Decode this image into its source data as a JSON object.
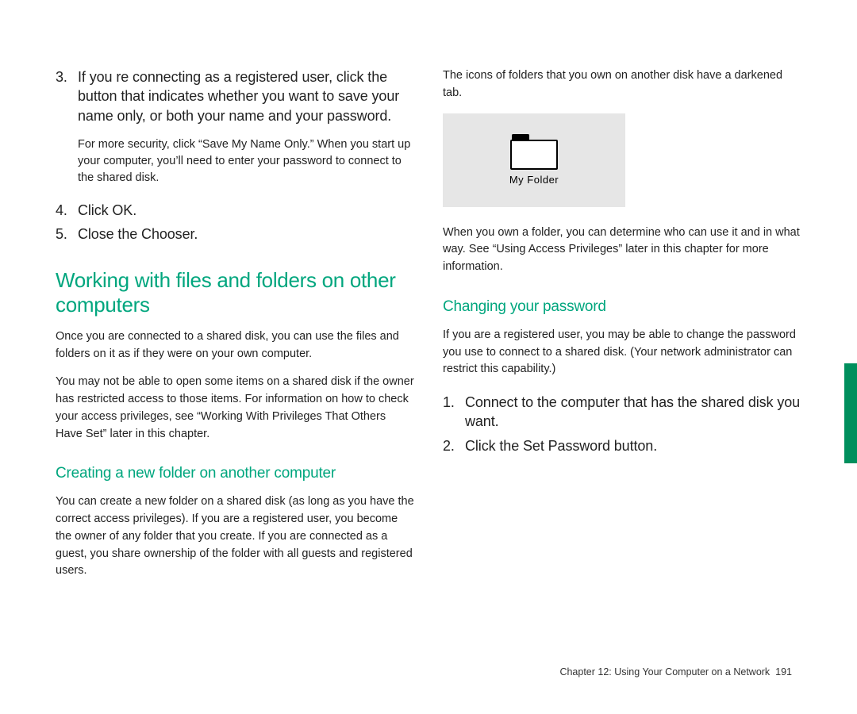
{
  "accent": "#00a67e",
  "left": {
    "step3_num": "3.",
    "step3_text": "If you re connecting as a registered user, click the button that indicates whether you want to save your name only, or both your name and your password.",
    "step3_fine": "For more security, click “Save My Name Only.” When you start up your computer, you’ll need to enter your password to connect to the shared disk.",
    "step4_num": "4.",
    "step4_text": "Click OK.",
    "step5_num": "5.",
    "step5_text": "Close the Chooser.",
    "h2": "Working with files and folders on other computers",
    "p1": "Once you are connected to a shared disk, you can use the files and folders on it as if they were on your own computer.",
    "p2": "You may not be able to open some items on a shared disk if the owner has restricted access to those items. For information on how to check your access privileges, see “Working With Privileges That Others Have Set” later in this chapter.",
    "h3": "Creating a new folder on another computer",
    "p3": "You can create a new folder on a shared disk (as long as you have the correct access privileges). If you are a registered user, you become the owner of any folder that you create. If you are connected as a guest, you share ownership of the folder with all guests and registered users."
  },
  "right": {
    "caption1": "The icons of folders that you own on another disk have a darkened tab.",
    "folder_label": "My Folder",
    "p1": "When you own a folder, you can determine who can use it and in what way. See “Using Access Privileges” later in this chapter for more information.",
    "h3": "Changing your password",
    "p2": "If you are a registered user, you may be able to change the password you use to connect to a shared disk. (Your network administrator can restrict this capability.)",
    "step1_num": "1.",
    "step1_text": "Connect to the computer that has the shared disk you want.",
    "step2_num": "2.",
    "step2_text": "Click the Set Password button."
  },
  "footer": {
    "chapter": "Chapter 12: Using Your Computer on a Network",
    "page": "191"
  }
}
